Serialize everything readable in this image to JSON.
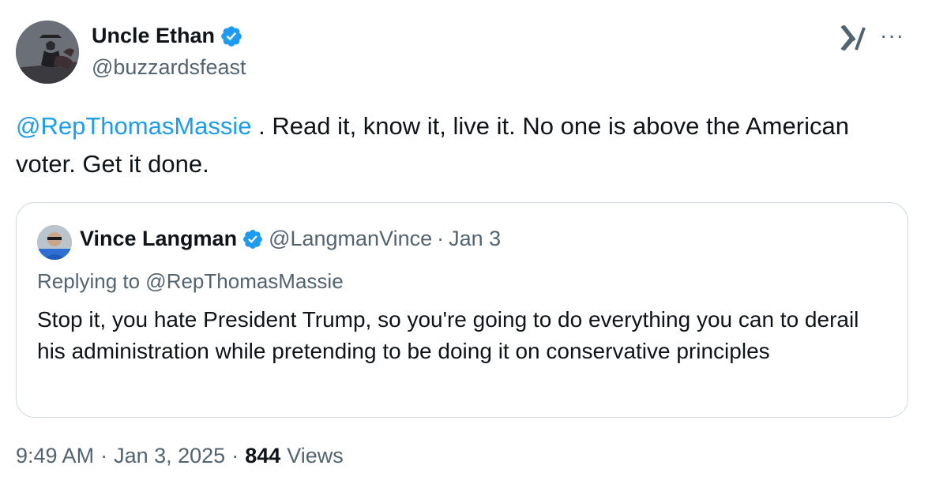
{
  "author": {
    "display_name": "Uncle Ethan",
    "handle": "@buzzardsfeast",
    "verified": true
  },
  "icons": {
    "verified": "verified-badge-icon",
    "brand": "x-logo-icon",
    "more": "more-options-icon"
  },
  "colors": {
    "accent": "#1d9bf0",
    "text": "#0f1419",
    "secondary": "#536471",
    "border": "#cfd9de"
  },
  "tweet": {
    "mention": "@RepThomasMassie",
    "text": " . Read it, know it, live it. No one is above the American voter. Get it done."
  },
  "quote": {
    "display_name": "Vince Langman",
    "handle": "@LangmanVince",
    "separator": "·",
    "date": "Jan 3",
    "replying_to": "Replying to @RepThomasMassie",
    "text": "Stop it, you hate President Trump, so you're going to do everything you can to derail his administration while pretending to be doing it on conservative principles"
  },
  "meta": {
    "time": "9:49 AM",
    "sep1": "·",
    "date": "Jan 3, 2025",
    "sep2": "·",
    "views_count": "844",
    "views_label": "Views"
  },
  "more_glyph": "···"
}
